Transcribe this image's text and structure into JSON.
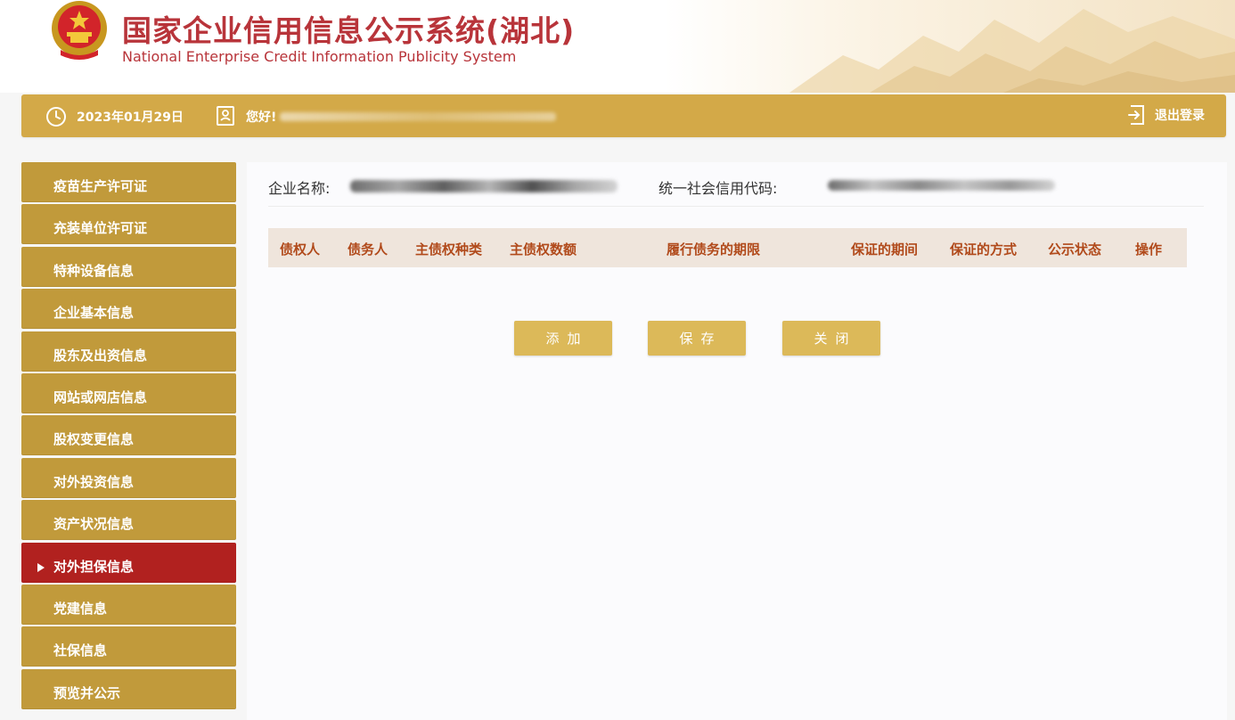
{
  "header": {
    "title_cn": "国家企业信用信息公示系统(湖北)",
    "title_en": "National Enterprise Credit Information Publicity System"
  },
  "topbar": {
    "date": "2023年01月29日",
    "greeting": "您好!",
    "logout_label": "退出登录"
  },
  "sidebar": {
    "items": [
      {
        "label": "疫苗生产许可证"
      },
      {
        "label": "充装单位许可证"
      },
      {
        "label": "特种设备信息"
      },
      {
        "label": "企业基本信息"
      },
      {
        "label": "股东及出资信息"
      },
      {
        "label": "网站或网店信息"
      },
      {
        "label": "股权变更信息"
      },
      {
        "label": "对外投资信息"
      },
      {
        "label": "资产状况信息"
      },
      {
        "label": "对外担保信息",
        "active": true
      },
      {
        "label": "党建信息"
      },
      {
        "label": "社保信息"
      },
      {
        "label": "预览并公示"
      }
    ]
  },
  "main": {
    "company_name_label": "企业名称:",
    "credit_code_label": "统一社会信用代码:",
    "table": {
      "columns": [
        "债权人",
        "债务人",
        "主债权种类",
        "主债权数额",
        "履行债务的期限",
        "保证的期间",
        "保证的方式",
        "公示状态",
        "操作"
      ]
    },
    "buttons": {
      "add": "添加",
      "save": "保存",
      "close": "关闭"
    }
  },
  "colors": {
    "brand_red": "#b8343a",
    "gold": "#d3a948",
    "sidebar_gold": "#c19a3b",
    "active_red": "#b1211f",
    "button_gold": "#dcb959",
    "table_header_bg": "#efe5dc",
    "table_header_text": "#b14a1b"
  },
  "icons": {
    "emblem": "national-emblem",
    "clock": "clock-icon",
    "user": "user-card-icon",
    "logout": "logout-icon"
  }
}
